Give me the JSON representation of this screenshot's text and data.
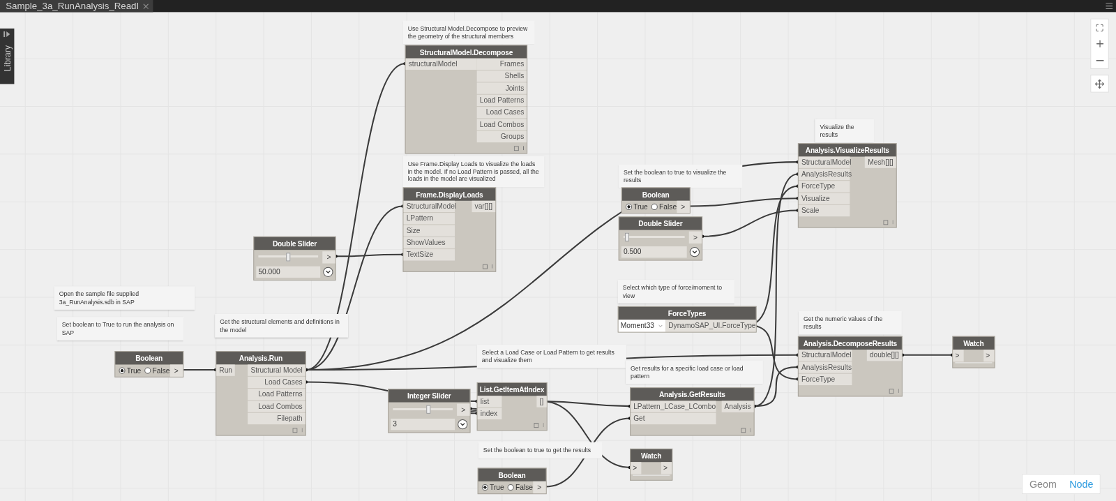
{
  "tab": {
    "title": "Sample_3a_RunAnalysis_ReadI"
  },
  "library": {
    "label": "Library"
  },
  "view_toggle": [
    {
      "label": "Geom",
      "selected": false
    },
    {
      "label": "Node",
      "selected": true
    }
  ],
  "notes": [
    "Use Structural Model.Decompose to preview the geometry of the structural members",
    "Visualize the results",
    "Use Frame.Display Loads to visualize the loads in the model. If no Load Pattern is passed, all the loads in the model are visualized",
    "Set the boolean to true to visualize the results",
    "Select which type of force/moment to view",
    "Open the sample file supplied 3a_RunAnalysis.sdb in SAP",
    "Set boolean to True to run the analysis on SAP",
    "Get the structural elements and definitions in the model",
    "Get the numeric values of the results",
    "Select a Load Case or Load Pattern to get results and visualize them",
    "Get results for a specific load case or load pattern",
    "Set the boolean to true to get the results"
  ],
  "nodes": [
    {
      "kind": "function",
      "title": "StructuralModel.Decompose",
      "inputs": [
        "structuralModel"
      ],
      "outputs": [
        "Frames",
        "Shells",
        "Joints",
        "Load Patterns",
        "Load Cases",
        "Load Combos",
        "Groups"
      ]
    },
    {
      "kind": "function",
      "title": "Analysis.VisualizeResults",
      "inputs": [
        "StructuralModel",
        "AnalysisResults",
        "ForceType",
        "Visualize",
        "Scale"
      ],
      "outputs": [
        "Mesh[][]"
      ]
    },
    {
      "kind": "function",
      "title": "Frame.DisplayLoads",
      "inputs": [
        "StructuralModel",
        "LPattern",
        "Size",
        "ShowValues",
        "TextSize"
      ],
      "outputs": [
        "var[][]"
      ]
    },
    {
      "kind": "boolean",
      "title": "Boolean",
      "options": [
        {
          "label": "True",
          "selected": true
        },
        {
          "label": "False",
          "selected": false
        }
      ],
      "output": ">"
    },
    {
      "kind": "slider",
      "title": "Double Slider",
      "value": "0.500",
      "level": 0.03,
      "output": ">"
    },
    {
      "kind": "slider",
      "title": "Double Slider",
      "value": "50.000",
      "level": 0.5,
      "output": ">"
    },
    {
      "kind": "dropdown",
      "title": "ForceTypes",
      "value": "Moment33",
      "output": "DynamoSAP_UI.ForceType"
    },
    {
      "kind": "boolean",
      "title": "Boolean",
      "options": [
        {
          "label": "True",
          "selected": true
        },
        {
          "label": "False",
          "selected": false
        }
      ],
      "output": ">"
    },
    {
      "kind": "function",
      "title": "Analysis.Run",
      "inputs": [
        "Run"
      ],
      "outputs": [
        "Structural Model",
        "Load Cases",
        "Load Patterns",
        "Load Combos",
        "Filepath"
      ]
    },
    {
      "kind": "slider",
      "title": "Integer Slider",
      "value": "3",
      "level": 0.6,
      "output": ">"
    },
    {
      "kind": "function",
      "title": "List.GetItemAtIndex",
      "inputs": [
        "list",
        "index"
      ],
      "outputs": [
        "[]"
      ]
    },
    {
      "kind": "function",
      "title": "Analysis.GetResults",
      "inputs": [
        "LPattern_LCase_LCombo",
        "Get"
      ],
      "outputs": [
        "Analysis"
      ]
    },
    {
      "kind": "function",
      "title": "Analysis.DecomposeResults",
      "inputs": [
        "StructuralModel",
        "AnalysisResults",
        "ForceType"
      ],
      "outputs": [
        "double[][]"
      ]
    },
    {
      "kind": "watch",
      "title": "Watch",
      "input": ">",
      "output": ">"
    },
    {
      "kind": "watch",
      "title": "Watch",
      "input": ">",
      "output": ">"
    },
    {
      "kind": "boolean",
      "title": "Boolean",
      "options": [
        {
          "label": "True",
          "selected": true
        },
        {
          "label": "False",
          "selected": false
        }
      ],
      "output": ">"
    }
  ]
}
